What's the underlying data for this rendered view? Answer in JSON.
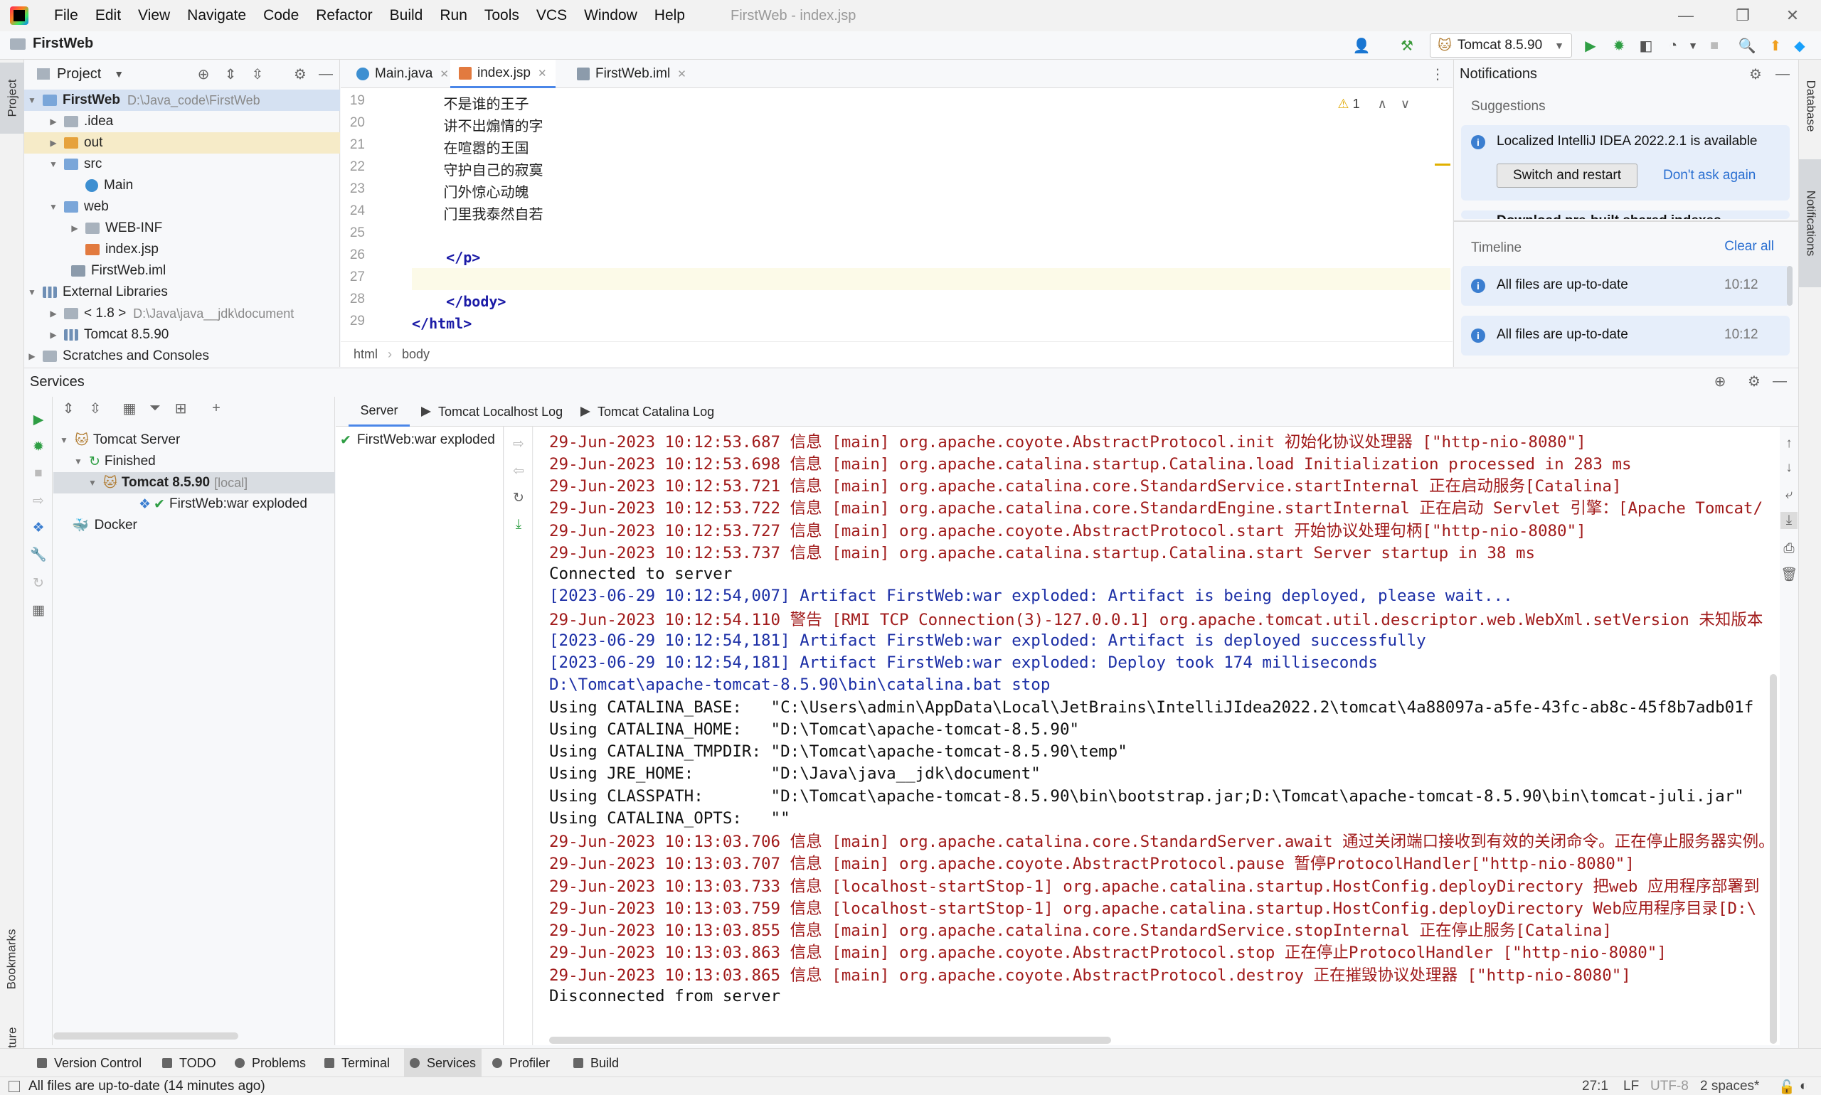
{
  "menu": [
    "File",
    "Edit",
    "View",
    "Navigate",
    "Code",
    "Refactor",
    "Build",
    "Run",
    "Tools",
    "VCS",
    "Window",
    "Help"
  ],
  "window_title": "FirstWeb - index.jsp",
  "toolbar": {
    "project_name": "FirstWeb",
    "run_config": "Tomcat 8.5.90"
  },
  "left_strip": {
    "project": "Project",
    "bookmarks": "Bookmarks",
    "structure": "Structure"
  },
  "right_strip": {
    "database": "Database",
    "notifications": "Notifications"
  },
  "project_panel": {
    "title": "Project",
    "tree": [
      {
        "label": "FirstWeb",
        "extra": "D:\\Java_code\\FirstWeb"
      },
      {
        "label": ".idea"
      },
      {
        "label": "out"
      },
      {
        "label": "src"
      },
      {
        "label": "Main"
      },
      {
        "label": "web"
      },
      {
        "label": "WEB-INF"
      },
      {
        "label": "index.jsp"
      },
      {
        "label": "FirstWeb.iml"
      },
      {
        "label": "External Libraries"
      },
      {
        "label": "< 1.8 >",
        "extra": "D:\\Java\\java__jdk\\document"
      },
      {
        "label": "Tomcat 8.5.90"
      },
      {
        "label": "Scratches and Consoles"
      }
    ]
  },
  "editor": {
    "tabs": [
      "Main.java",
      "index.jsp",
      "FirstWeb.iml"
    ],
    "warning_count": "1",
    "line_numbers": [
      "19",
      "20",
      "21",
      "22",
      "23",
      "24",
      "25",
      "26",
      "27",
      "28",
      "29"
    ],
    "lines": [
      "        不是谁的王子",
      "        讲不出煽情的字",
      "        在喧嚣的王国",
      "        守护自己的寂寞",
      "        门外惊心动魄",
      "        门里我泰然自若",
      "",
      "    </p>",
      "",
      "    </body>",
      "</html>"
    ],
    "breadcrumb": [
      "html",
      "body"
    ]
  },
  "notifications": {
    "title": "Notifications",
    "suggestions_label": "Suggestions",
    "suggestion_text": "Localized IntelliJ IDEA 2022.2.1 is available",
    "switch_button": "Switch and restart",
    "dont_ask": "Don't ask again",
    "partial_text": "Download pre-built shared indexes",
    "timeline_label": "Timeline",
    "clear_all": "Clear all",
    "timeline": [
      {
        "text": "All files are up-to-date",
        "time": "10:12"
      },
      {
        "text": "All files are up-to-date",
        "time": "10:12"
      }
    ]
  },
  "services": {
    "title": "Services",
    "tree": [
      {
        "label": "Tomcat Server"
      },
      {
        "label": "Finished"
      },
      {
        "label": "Tomcat 8.5.90",
        "extra": "[local]"
      },
      {
        "label": "FirstWeb:war exploded"
      },
      {
        "label": "Docker"
      }
    ],
    "deployment": "FirstWeb:war exploded",
    "console_tabs": [
      "Server",
      "Tomcat Localhost Log",
      "Tomcat Catalina Log"
    ],
    "console": [
      "29-Jun-2023 10:12:53.687 信息 [main] org.apache.coyote.AbstractProtocol.init 初始化协议处理器 [\"http-nio-8080\"]",
      "29-Jun-2023 10:12:53.698 信息 [main] org.apache.catalina.startup.Catalina.load Initialization processed in 283 ms",
      "29-Jun-2023 10:12:53.721 信息 [main] org.apache.catalina.core.StandardService.startInternal 正在启动服务[Catalina]",
      "29-Jun-2023 10:12:53.722 信息 [main] org.apache.catalina.core.StandardEngine.startInternal 正在启动 Servlet 引擎：[Apache Tomcat/",
      "29-Jun-2023 10:12:53.727 信息 [main] org.apache.coyote.AbstractProtocol.start 开始协议处理句柄[\"http-nio-8080\"]",
      "29-Jun-2023 10:12:53.737 信息 [main] org.apache.catalina.startup.Catalina.start Server startup in 38 ms",
      "Connected to server",
      "[2023-06-29 10:12:54,007] Artifact FirstWeb:war exploded: Artifact is being deployed, please wait...",
      "29-Jun-2023 10:12:54.110 警告 [RMI TCP Connection(3)-127.0.0.1] org.apache.tomcat.util.descriptor.web.WebXml.setVersion 未知版本",
      "[2023-06-29 10:12:54,181] Artifact FirstWeb:war exploded: Artifact is deployed successfully",
      "[2023-06-29 10:12:54,181] Artifact FirstWeb:war exploded: Deploy took 174 milliseconds",
      "D:\\Tomcat\\apache-tomcat-8.5.90\\bin\\catalina.bat stop",
      "Using CATALINA_BASE:   \"C:\\Users\\admin\\AppData\\Local\\JetBrains\\IntelliJIdea2022.2\\tomcat\\4a88097a-a5fe-43fc-ab8c-45f8b7adb01f",
      "Using CATALINA_HOME:   \"D:\\Tomcat\\apache-tomcat-8.5.90\"",
      "Using CATALINA_TMPDIR: \"D:\\Tomcat\\apache-tomcat-8.5.90\\temp\"",
      "Using JRE_HOME:        \"D:\\Java\\java__jdk\\document\"",
      "Using CLASSPATH:       \"D:\\Tomcat\\apache-tomcat-8.5.90\\bin\\bootstrap.jar;D:\\Tomcat\\apache-tomcat-8.5.90\\bin\\tomcat-juli.jar\"",
      "Using CATALINA_OPTS:   \"\"",
      "29-Jun-2023 10:13:03.706 信息 [main] org.apache.catalina.core.StandardServer.await 通过关闭端口接收到有效的关闭命令。正在停止服务器实例。",
      "29-Jun-2023 10:13:03.707 信息 [main] org.apache.coyote.AbstractProtocol.pause 暂停ProtocolHandler[\"http-nio-8080\"]",
      "29-Jun-2023 10:13:03.733 信息 [localhost-startStop-1] org.apache.catalina.startup.HostConfig.deployDirectory 把web 应用程序部署到",
      "29-Jun-2023 10:13:03.759 信息 [localhost-startStop-1] org.apache.catalina.startup.HostConfig.deployDirectory Web应用程序目录[D:\\",
      "29-Jun-2023 10:13:03.855 信息 [main] org.apache.catalina.core.StandardService.stopInternal 正在停止服务[Catalina]",
      "29-Jun-2023 10:13:03.863 信息 [main] org.apache.coyote.AbstractProtocol.stop 正在停止ProtocolHandler [\"http-nio-8080\"]",
      "29-Jun-2023 10:13:03.865 信息 [main] org.apache.coyote.AbstractProtocol.destroy 正在摧毁协议处理器 [\"http-nio-8080\"]",
      "Disconnected from server"
    ]
  },
  "bottom_tabs": [
    "Version Control",
    "TODO",
    "Problems",
    "Terminal",
    "Services",
    "Profiler",
    "Build"
  ],
  "status": {
    "message": "All files are up-to-date (14 minutes ago)",
    "position": "27:1",
    "line_sep": "LF",
    "encoding": "UTF-8",
    "indent": "2 spaces*"
  },
  "colors": {
    "accent": "#4a86e8",
    "log_red": "#a11b1b",
    "log_blue": "#1c2fa6"
  }
}
